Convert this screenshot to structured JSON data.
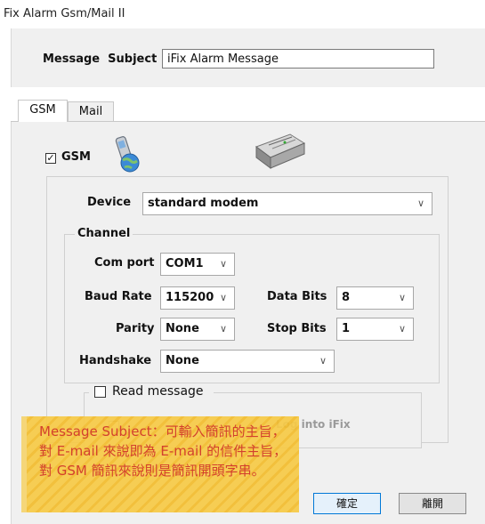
{
  "window": {
    "title": "Fix Alarm Gsm/Mail II"
  },
  "subject": {
    "label": "Message  Subject",
    "value": "iFix Alarm Message"
  },
  "tabs": [
    {
      "label": "GSM"
    },
    {
      "label": "Mail"
    }
  ],
  "gsm": {
    "enable_label": "GSM",
    "enabled_glyph": "✓",
    "device": {
      "label": "Device",
      "value": "standard modem"
    },
    "channel": {
      "title": "Channel",
      "com_port": {
        "label": "Com port",
        "value": "COM1"
      },
      "baud_rate": {
        "label": "Baud Rate",
        "value": "115200"
      },
      "data_bits": {
        "label": "Data Bits",
        "value": "8"
      },
      "parity": {
        "label": "Parity",
        "value": "None"
      },
      "stop_bits": {
        "label": "Stop Bits",
        "value": "1"
      },
      "handshake": {
        "label": "Handshake",
        "value": "None"
      }
    },
    "read_message": {
      "label": "Read message",
      "log_into_ifix": "Log into iFix"
    }
  },
  "buttons": {
    "ok": "確定",
    "exit": "離開"
  },
  "annotation": {
    "text": "Message Subject：可輸入簡訊的主旨，對 E-mail 來說即為 E-mail 的信件主旨，對 GSM 簡訊來說則是簡訊開頭字串。"
  },
  "icons": [
    "phone-globe-icon",
    "modem-device-icon",
    "chevron-down-icon"
  ],
  "colors": {
    "panel": "#f0f0f0",
    "note": "#f7ca46",
    "note_text": "#d3402d",
    "ok_border": "#0078d7"
  }
}
